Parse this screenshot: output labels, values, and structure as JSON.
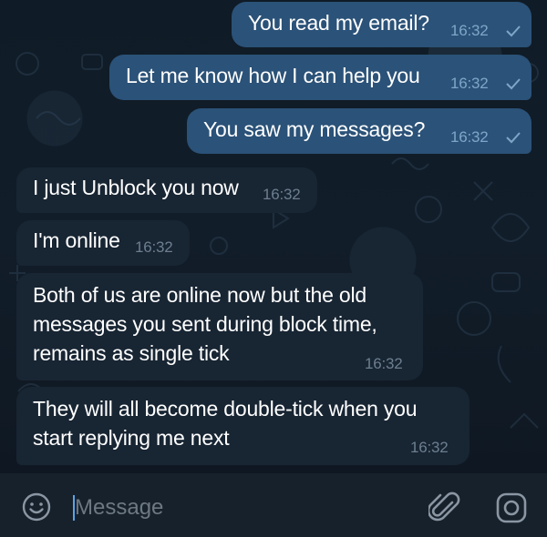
{
  "messages": [
    {
      "direction": "out",
      "text": "You read my email?",
      "time": "16:32",
      "status": "check-icon"
    },
    {
      "direction": "out",
      "text": "Let me know how I can help you",
      "time": "16:32",
      "status": "check-icon"
    },
    {
      "direction": "out",
      "text": "You saw my messages?",
      "time": "16:32",
      "status": "check-icon"
    },
    {
      "direction": "in",
      "text": "I just Unblock you now",
      "time": "16:32"
    },
    {
      "direction": "in",
      "text": "I'm online",
      "time": "16:32"
    },
    {
      "direction": "in",
      "lines": [
        "Both of us are online now but the old",
        "messages you sent during block time,",
        "remains as single tick"
      ],
      "time": "16:32"
    },
    {
      "direction": "in",
      "lines": [
        "They will all become double-tick when you",
        "start replying me next"
      ],
      "time": "16:32"
    }
  ],
  "composer": {
    "placeholder": "Message",
    "left_icon": "emoji-icon",
    "right_icons": [
      "paperclip-icon",
      "camera-icon"
    ]
  },
  "colors": {
    "chat_background": "#0e1621",
    "outgoing_bubble": "#2b5278",
    "incoming_bubble": "#182533",
    "composer_background": "#17212b",
    "caret": "#5aa5e6"
  }
}
